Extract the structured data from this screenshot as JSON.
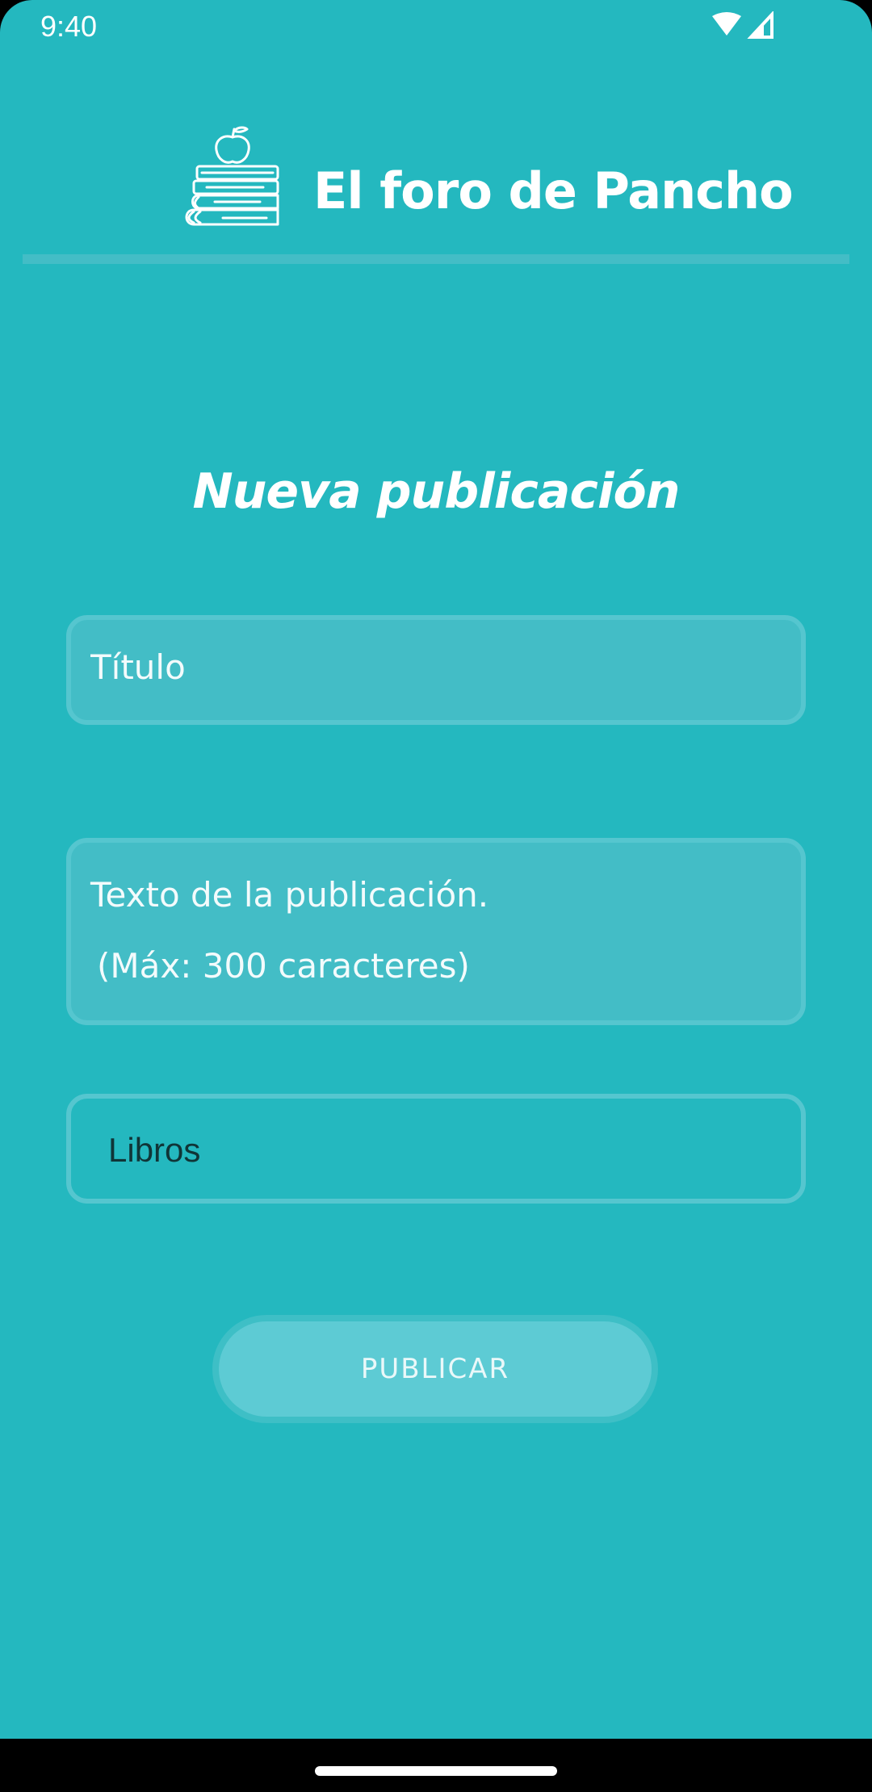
{
  "status_bar": {
    "time": "9:40",
    "icons": [
      "wifi-icon",
      "cell-signal-icon"
    ]
  },
  "header": {
    "logo_icon": "books-apple-icon",
    "app_title": "El foro de Pancho"
  },
  "page": {
    "title": "Nueva publicación"
  },
  "form": {
    "title_field": {
      "placeholder": "Título",
      "value": ""
    },
    "body_field": {
      "placeholder_line1": "Texto de la publicación.",
      "placeholder_line2": "(Máx: 300 caracteres)"
    },
    "category_field": {
      "value": "Libros"
    },
    "publish_label": "PUBLICAR"
  },
  "colors": {
    "background": "#24B8BF",
    "field_fill": "#43BDC6",
    "field_border": "#55C6CF",
    "button_fill": "#5DCBD4",
    "text": "#FFFFFF"
  }
}
